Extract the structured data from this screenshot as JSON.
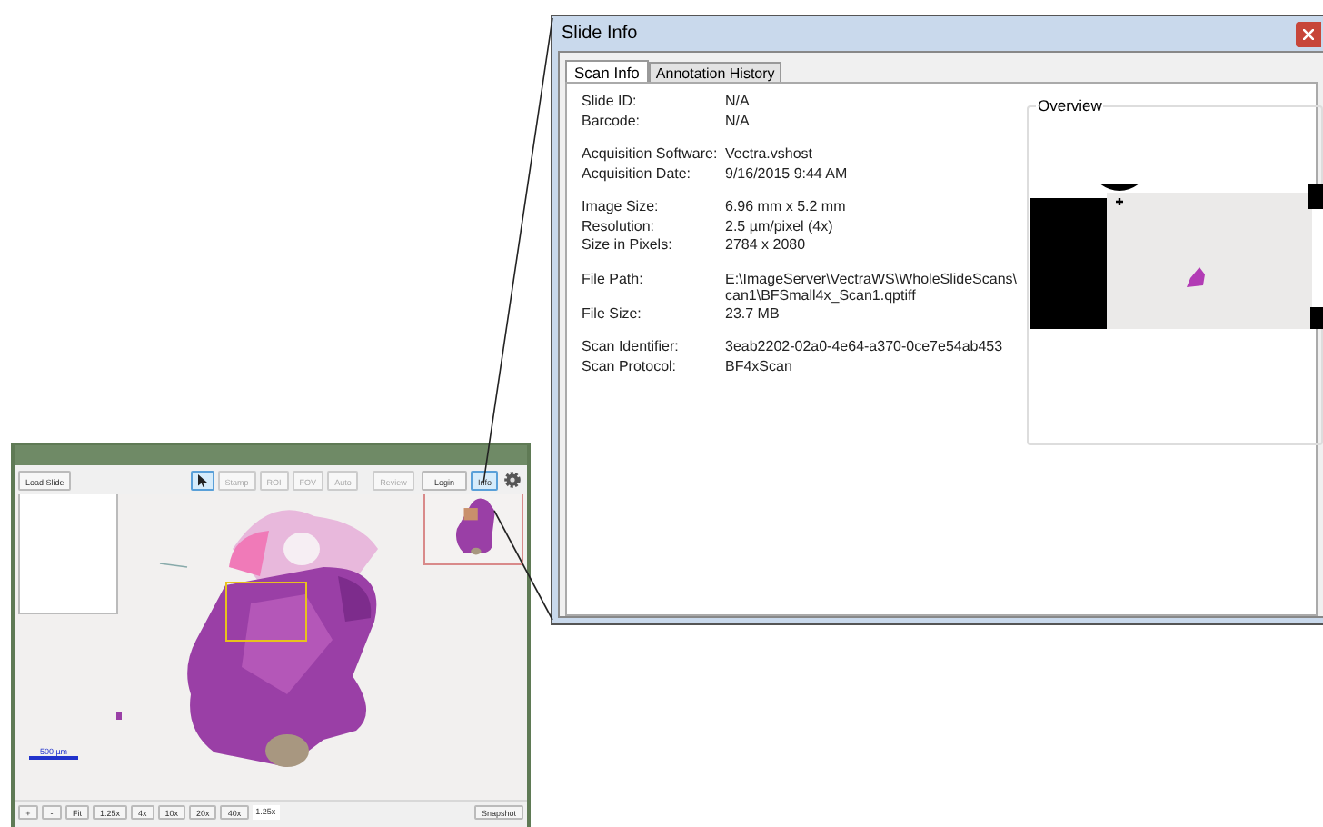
{
  "viewer": {
    "load_button": "Load Slide",
    "tools": [
      {
        "kind": "pointer",
        "selected": true,
        "disabled": false
      },
      {
        "kind": "text",
        "label": "Stamp",
        "selected": false,
        "disabled": true
      },
      {
        "kind": "text",
        "label": "ROI",
        "selected": false,
        "disabled": true
      },
      {
        "kind": "text",
        "label": "FOV",
        "selected": false,
        "disabled": true
      },
      {
        "kind": "text",
        "label": "Auto",
        "selected": false,
        "disabled": true
      },
      {
        "kind": "text",
        "label": "Review",
        "selected": false,
        "disabled": true
      }
    ],
    "login_button": "Login",
    "info_button": {
      "label": "Info",
      "selected": true
    },
    "scale_bar": "500 µm",
    "zoom_buttons": [
      "+",
      "-",
      "Fit",
      "1.25x",
      "4x",
      "10x",
      "20x",
      "40x"
    ],
    "zoom_level": "1.25x",
    "snapshot_button": "Snapshot"
  },
  "dialog": {
    "title": "Slide Info",
    "tabs": [
      {
        "label": "Scan Info",
        "selected": true
      },
      {
        "label": "Annotation History",
        "selected": false
      }
    ],
    "groups": [
      [
        {
          "label": "Slide ID:",
          "value": [
            "N/A"
          ]
        },
        {
          "label": "Barcode:",
          "value": [
            "N/A"
          ]
        }
      ],
      [
        {
          "label": "Acquisition Software:",
          "value": [
            "Vectra.vshost"
          ]
        },
        {
          "label": "Acquisition Date:",
          "value": [
            "9/16/2015 9:44 AM"
          ]
        }
      ],
      [
        {
          "label": "Image Size:",
          "value": [
            "6.96 mm x 5.2 mm"
          ]
        },
        {
          "label": "Resolution:",
          "value": [
            "2.5 µm/pixel (4x)"
          ]
        },
        {
          "label": "Size in Pixels:",
          "value": [
            "2784 x 2080"
          ]
        }
      ],
      [
        {
          "label": "File Path:",
          "value": [
            "E:\\ImageServer\\VectraWS\\WholeSlideScans\\",
            "can1\\BFSmall4x_Scan1.qptiff"
          ]
        },
        {
          "label": "File Size:",
          "value": [
            "23.7 MB"
          ]
        }
      ],
      [
        {
          "label": "Scan Identifier:",
          "value": [
            "3eab2202-02a0-4e64-a370-0ce7e54ab453"
          ]
        },
        {
          "label": "Scan Protocol:",
          "value": [
            "BF4xScan"
          ]
        }
      ]
    ],
    "overview_title": "Overview"
  }
}
